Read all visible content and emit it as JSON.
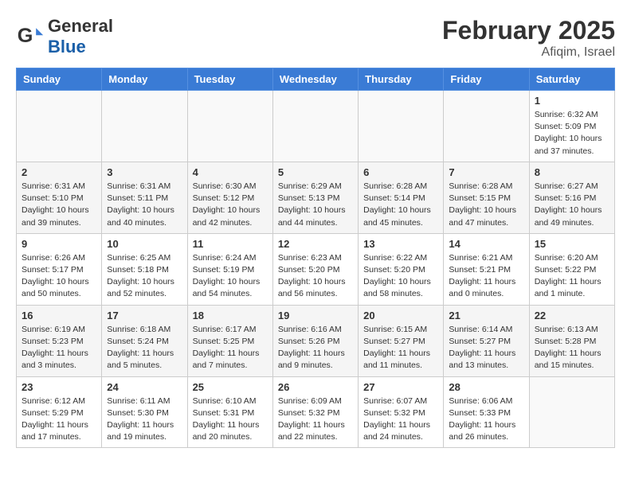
{
  "header": {
    "logo_text_general": "General",
    "logo_text_blue": "Blue",
    "month_year": "February 2025",
    "location": "Afiqim, Israel"
  },
  "weekdays": [
    "Sunday",
    "Monday",
    "Tuesday",
    "Wednesday",
    "Thursday",
    "Friday",
    "Saturday"
  ],
  "weeks": [
    [
      {
        "day": "",
        "info": ""
      },
      {
        "day": "",
        "info": ""
      },
      {
        "day": "",
        "info": ""
      },
      {
        "day": "",
        "info": ""
      },
      {
        "day": "",
        "info": ""
      },
      {
        "day": "",
        "info": ""
      },
      {
        "day": "1",
        "info": "Sunrise: 6:32 AM\nSunset: 5:09 PM\nDaylight: 10 hours\nand 37 minutes."
      }
    ],
    [
      {
        "day": "2",
        "info": "Sunrise: 6:31 AM\nSunset: 5:10 PM\nDaylight: 10 hours\nand 39 minutes."
      },
      {
        "day": "3",
        "info": "Sunrise: 6:31 AM\nSunset: 5:11 PM\nDaylight: 10 hours\nand 40 minutes."
      },
      {
        "day": "4",
        "info": "Sunrise: 6:30 AM\nSunset: 5:12 PM\nDaylight: 10 hours\nand 42 minutes."
      },
      {
        "day": "5",
        "info": "Sunrise: 6:29 AM\nSunset: 5:13 PM\nDaylight: 10 hours\nand 44 minutes."
      },
      {
        "day": "6",
        "info": "Sunrise: 6:28 AM\nSunset: 5:14 PM\nDaylight: 10 hours\nand 45 minutes."
      },
      {
        "day": "7",
        "info": "Sunrise: 6:28 AM\nSunset: 5:15 PM\nDaylight: 10 hours\nand 47 minutes."
      },
      {
        "day": "8",
        "info": "Sunrise: 6:27 AM\nSunset: 5:16 PM\nDaylight: 10 hours\nand 49 minutes."
      }
    ],
    [
      {
        "day": "9",
        "info": "Sunrise: 6:26 AM\nSunset: 5:17 PM\nDaylight: 10 hours\nand 50 minutes."
      },
      {
        "day": "10",
        "info": "Sunrise: 6:25 AM\nSunset: 5:18 PM\nDaylight: 10 hours\nand 52 minutes."
      },
      {
        "day": "11",
        "info": "Sunrise: 6:24 AM\nSunset: 5:19 PM\nDaylight: 10 hours\nand 54 minutes."
      },
      {
        "day": "12",
        "info": "Sunrise: 6:23 AM\nSunset: 5:20 PM\nDaylight: 10 hours\nand 56 minutes."
      },
      {
        "day": "13",
        "info": "Sunrise: 6:22 AM\nSunset: 5:20 PM\nDaylight: 10 hours\nand 58 minutes."
      },
      {
        "day": "14",
        "info": "Sunrise: 6:21 AM\nSunset: 5:21 PM\nDaylight: 11 hours\nand 0 minutes."
      },
      {
        "day": "15",
        "info": "Sunrise: 6:20 AM\nSunset: 5:22 PM\nDaylight: 11 hours\nand 1 minute."
      }
    ],
    [
      {
        "day": "16",
        "info": "Sunrise: 6:19 AM\nSunset: 5:23 PM\nDaylight: 11 hours\nand 3 minutes."
      },
      {
        "day": "17",
        "info": "Sunrise: 6:18 AM\nSunset: 5:24 PM\nDaylight: 11 hours\nand 5 minutes."
      },
      {
        "day": "18",
        "info": "Sunrise: 6:17 AM\nSunset: 5:25 PM\nDaylight: 11 hours\nand 7 minutes."
      },
      {
        "day": "19",
        "info": "Sunrise: 6:16 AM\nSunset: 5:26 PM\nDaylight: 11 hours\nand 9 minutes."
      },
      {
        "day": "20",
        "info": "Sunrise: 6:15 AM\nSunset: 5:27 PM\nDaylight: 11 hours\nand 11 minutes."
      },
      {
        "day": "21",
        "info": "Sunrise: 6:14 AM\nSunset: 5:27 PM\nDaylight: 11 hours\nand 13 minutes."
      },
      {
        "day": "22",
        "info": "Sunrise: 6:13 AM\nSunset: 5:28 PM\nDaylight: 11 hours\nand 15 minutes."
      }
    ],
    [
      {
        "day": "23",
        "info": "Sunrise: 6:12 AM\nSunset: 5:29 PM\nDaylight: 11 hours\nand 17 minutes."
      },
      {
        "day": "24",
        "info": "Sunrise: 6:11 AM\nSunset: 5:30 PM\nDaylight: 11 hours\nand 19 minutes."
      },
      {
        "day": "25",
        "info": "Sunrise: 6:10 AM\nSunset: 5:31 PM\nDaylight: 11 hours\nand 20 minutes."
      },
      {
        "day": "26",
        "info": "Sunrise: 6:09 AM\nSunset: 5:32 PM\nDaylight: 11 hours\nand 22 minutes."
      },
      {
        "day": "27",
        "info": "Sunrise: 6:07 AM\nSunset: 5:32 PM\nDaylight: 11 hours\nand 24 minutes."
      },
      {
        "day": "28",
        "info": "Sunrise: 6:06 AM\nSunset: 5:33 PM\nDaylight: 11 hours\nand 26 minutes."
      },
      {
        "day": "",
        "info": ""
      }
    ]
  ]
}
